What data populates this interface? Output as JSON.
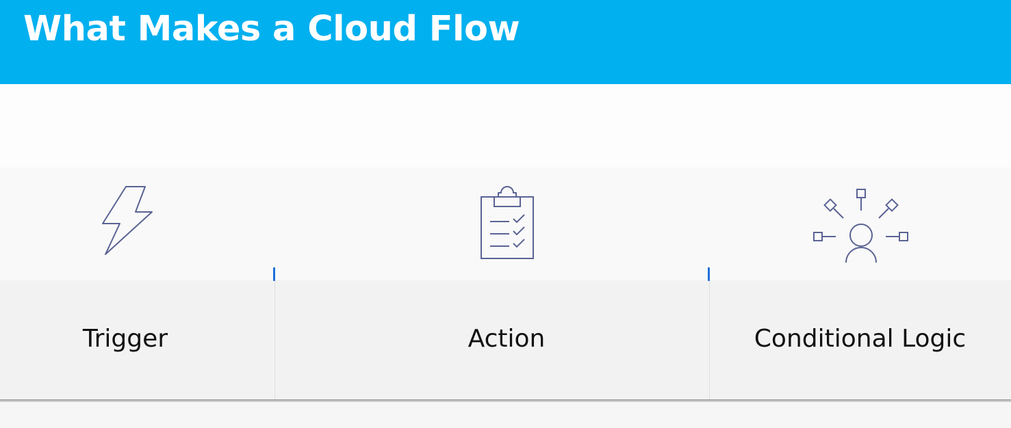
{
  "slide": {
    "title": "What Makes a Cloud Flow",
    "title_bar_color": "#00b0ef",
    "accent_marker_color": "#1e6fd9",
    "icon_stroke_color": "#5a6394"
  },
  "components": [
    {
      "label": "Trigger",
      "icon": "lightning-bolt-icon"
    },
    {
      "label": "Action",
      "icon": "clipboard-checklist-icon"
    },
    {
      "label": "Conditional Logic",
      "icon": "person-branching-icon"
    }
  ]
}
